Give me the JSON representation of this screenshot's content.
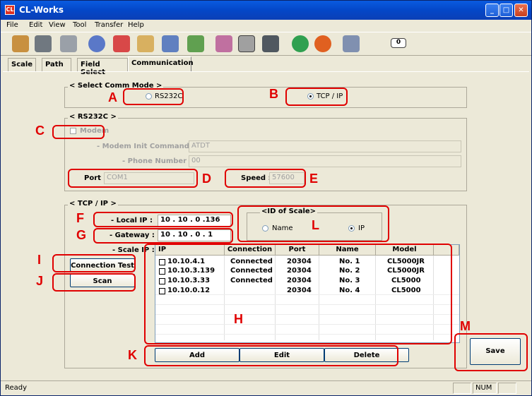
{
  "window": {
    "title": "CL-Works"
  },
  "menu": [
    "File",
    "Edit",
    "View",
    "Tool",
    "Transfer",
    "Help"
  ],
  "toolbar_icons": [
    "open-folder-icon",
    "save-disk-icon",
    "print-icon",
    "plu-icon",
    "star-icon",
    "upload-icon",
    "download-icon",
    "people-icon",
    "grid-icon",
    "label-icon",
    "keyboard-icon",
    "go-icon",
    "back-icon",
    "settings-icon",
    "counter-icon"
  ],
  "toolbar_counter": "0",
  "tabs": [
    "Scale",
    "Path",
    "Field Select",
    "Communication"
  ],
  "comm_mode": {
    "title": "< Select Comm Mode >",
    "rs232c": "RS232C",
    "tcpip": "TCP / IP"
  },
  "rs232c": {
    "title": "< RS232C >",
    "modem": "Modem",
    "modem_init_label": "- Modem Init Command :",
    "modem_init_value": "ATDT",
    "phone_label": "- Phone Number :",
    "phone_value": "00",
    "port_label": "Port :",
    "port_value": "COM1",
    "speed_label": "Speed :",
    "speed_value": "57600"
  },
  "tcpip": {
    "title": "< TCP / IP >",
    "local_ip_label": "- Local IP :",
    "local_ip_value": "10 . 10 . 0 .136",
    "gateway_label": "- Gateway :",
    "gateway_value": "10 . 10 . 0 . 1",
    "scale_ip_label": "- Scale IP :",
    "id_of_scale": {
      "title": "<ID of Scale>",
      "name": "Name",
      "ip": "IP"
    },
    "connection_test": "Connection Test",
    "scan": "Scan",
    "columns": [
      "IP",
      "Connection",
      "Port",
      "Name",
      "Model"
    ],
    "rows": [
      {
        "ip": "10.10.4.1",
        "connection": "Connected",
        "port": "20304",
        "name": "No. 1",
        "model": "CL5000JR"
      },
      {
        "ip": "10.10.3.139",
        "connection": "Connected",
        "port": "20304",
        "name": "No. 2",
        "model": "CL5000JR"
      },
      {
        "ip": "10.10.3.33",
        "connection": "Connected",
        "port": "20304",
        "name": "No. 3",
        "model": "CL5000"
      },
      {
        "ip": "10.10.0.12",
        "connection": "",
        "port": "20304",
        "name": "No. 4",
        "model": "CL5000"
      }
    ],
    "add": "Add",
    "edit": "Edit",
    "delete": "Delete"
  },
  "save": "Save",
  "status": {
    "left": "Ready",
    "num": "NUM"
  },
  "callouts": [
    "A",
    "B",
    "C",
    "D",
    "E",
    "F",
    "G",
    "H",
    "I",
    "J",
    "K",
    "L",
    "M"
  ],
  "colors": {
    "callout": "#e00000",
    "titlebar": "#0a5be0"
  }
}
